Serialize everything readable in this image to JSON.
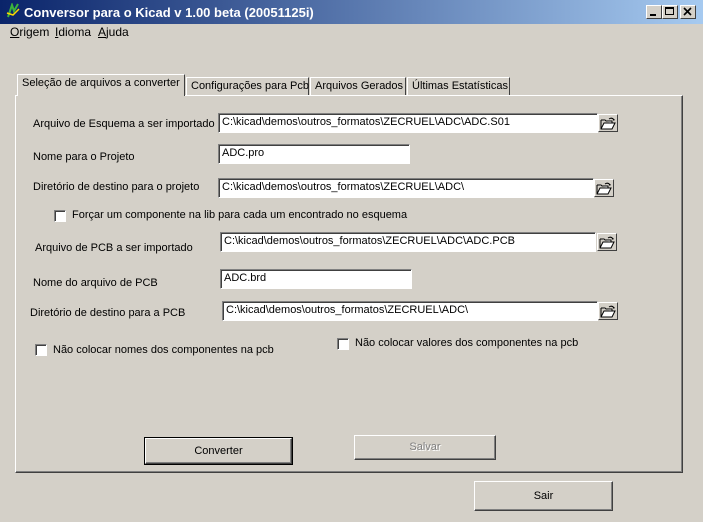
{
  "window": {
    "title": "Conversor para o Kicad v 1.00 beta (20051125i)"
  },
  "menu": {
    "items": [
      {
        "key": "O",
        "rest": "rigem"
      },
      {
        "key": "I",
        "rest": "dioma"
      },
      {
        "key": "A",
        "rest": "juda"
      }
    ]
  },
  "tabs": [
    {
      "label": "Seleção de arquivos a converter",
      "active": true
    },
    {
      "label": "Configurações para Pcb"
    },
    {
      "label": "Arquivos Gerados"
    },
    {
      "label": "Últimas Estatísticas"
    }
  ],
  "form": {
    "schematic_label": "Arquivo de Esquema a ser importado",
    "schematic_value": "C:\\kicad\\demos\\outros_formatos\\ZECRUEL\\ADC\\ADC.S01",
    "project_label": "Nome para o Projeto",
    "project_value": "ADC.pro",
    "dest_project_label": "Diretório de destino para o projeto",
    "dest_project_value": "C:\\kicad\\demos\\outros_formatos\\ZECRUEL\\ADC\\",
    "force_component_label": "Forçar um componente na lib para cada um encontrado no esquema",
    "pcb_label": "Arquivo de PCB a ser importado",
    "pcb_value": "C:\\kicad\\demos\\outros_formatos\\ZECRUEL\\ADC\\ADC.PCB",
    "pcb_name_label": "Nome do arquivo de PCB",
    "pcb_name_value": "ADC.brd",
    "dest_pcb_label": "Diretório de destino para a PCB",
    "dest_pcb_value": "C:\\kicad\\demos\\outros_formatos\\ZECRUEL\\ADC\\",
    "no_names_label": "Não colocar nomes dos componentes na pcb",
    "no_values_label": "Não colocar valores dos componentes na pcb"
  },
  "buttons": {
    "convert": "Converter",
    "save": "Salvar",
    "exit": "Sair"
  }
}
